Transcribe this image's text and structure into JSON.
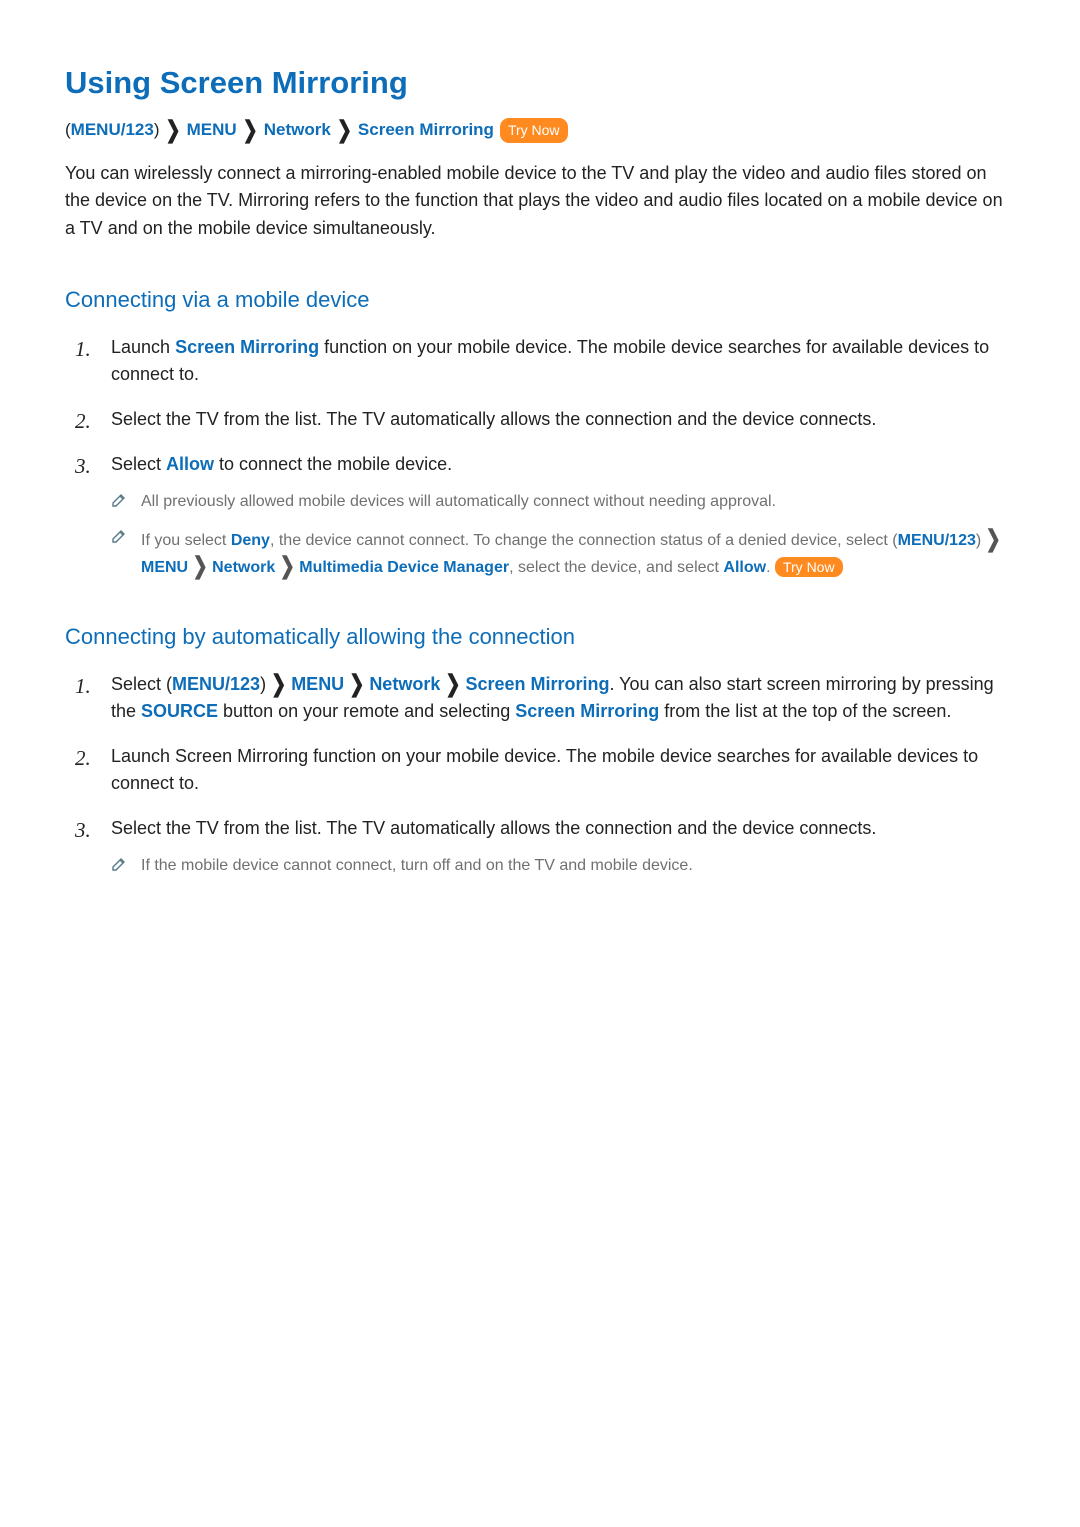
{
  "title": "Using Screen Mirroring",
  "breadcrumb": {
    "open": "(",
    "menu123": "MENU/123",
    "close": ")",
    "menu": "MENU",
    "network": "Network",
    "sm": "Screen Mirroring",
    "tryNow": "Try Now"
  },
  "intro": "You can wirelessly connect a mirroring-enabled mobile device to the TV and play the video and audio files stored on the device on the TV. Mirroring refers to the function that plays the video and audio files located on a mobile device on a TV and on the mobile device simultaneously.",
  "section1": {
    "title": "Connecting via a mobile device",
    "steps": [
      {
        "pre": "Launch ",
        "hl": "Screen Mirroring",
        "post": " function on your mobile device. The mobile device searches for available devices to connect to."
      },
      {
        "full": "Select the TV from the list. The TV automatically allows the connection and the device connects."
      },
      {
        "pre": "Select ",
        "hl": "Allow",
        "post": " to connect the mobile device."
      }
    ],
    "notes": [
      {
        "text": "All previously allowed mobile devices will automatically connect without needing approval."
      },
      {
        "pre": "If you select ",
        "deny": "Deny",
        "mid1": ", the device cannot connect. To change the connection status of a denied device, select ",
        "open": "(",
        "menu123": "MENU/123",
        "close": ")",
        "menu": "MENU",
        "network": "Network",
        "mdm": "Multimedia Device Manager",
        "mid2": ", select the device, and select ",
        "allow": "Allow",
        "end": ". ",
        "tryNow": "Try Now"
      }
    ]
  },
  "section2": {
    "title": "Connecting by automatically allowing the connection",
    "steps": [
      {
        "pre": "Select ",
        "open": "(",
        "menu123": "MENU/123",
        "close": ")",
        "menu": "MENU",
        "network": "Network",
        "sm": "Screen Mirroring",
        "mid1": ". You can also start screen mirroring by pressing the ",
        "source": "SOURCE",
        "mid2": " button on your remote and selecting ",
        "sm2": "Screen Mirroring",
        "post": " from the list at the top of the screen."
      },
      {
        "full": "Launch Screen Mirroring function on your mobile device. The mobile device searches for available devices to connect to."
      },
      {
        "full": "Select the TV from the list. The TV automatically allows the connection and the device connects."
      }
    ],
    "notes": [
      {
        "text": "If the mobile device cannot connect, turn off and on the TV and mobile device."
      }
    ]
  }
}
